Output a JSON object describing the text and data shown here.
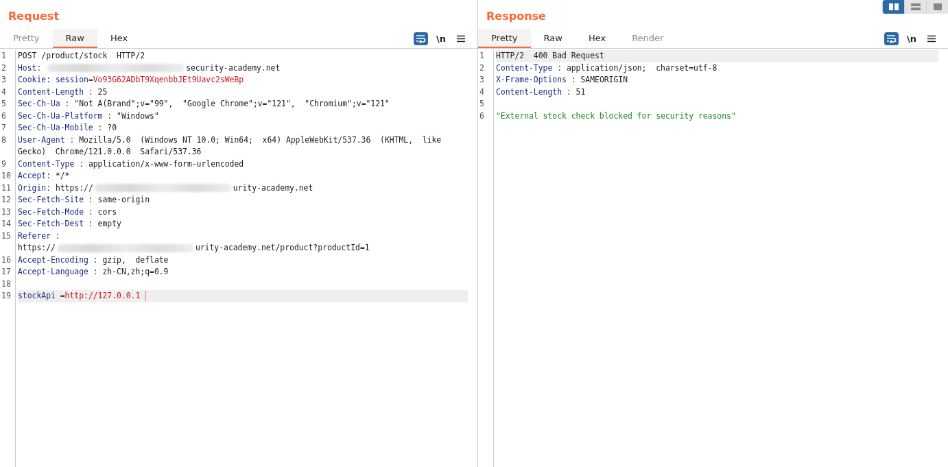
{
  "layout_buttons": [
    {
      "kind": "columns",
      "selected": true
    },
    {
      "kind": "rows",
      "selected": false
    },
    {
      "kind": "single",
      "selected": false
    }
  ],
  "panels": [
    {
      "title": "Request",
      "tabs": [
        {
          "label": "Pretty",
          "selected": false,
          "disabled": true
        },
        {
          "label": "Raw",
          "selected": true,
          "disabled": false
        },
        {
          "label": "Hex",
          "selected": false,
          "disabled": false
        }
      ],
      "wrap_on": true,
      "newline_label": "\\n",
      "lines": [
        {
          "number": "1",
          "current": false,
          "segments": [
            {
              "kind": "plain",
              "text": "POST /product/stock  HTTP/2"
            }
          ]
        },
        {
          "number": "2",
          "current": false,
          "segments": [
            {
              "kind": "name",
              "text": "Host"
            },
            {
              "kind": "sep",
              "text": ": "
            },
            {
              "kind": "redacted"
            },
            {
              "kind": "plain",
              "text": "security-academy.net"
            }
          ]
        },
        {
          "number": "3",
          "current": false,
          "segments": [
            {
              "kind": "name",
              "text": "Cookie"
            },
            {
              "kind": "sep",
              "text": ": "
            },
            {
              "kind": "param",
              "text": "session"
            },
            {
              "kind": "sep",
              "text": "="
            },
            {
              "kind": "param-value",
              "text": "Vo93G62ADbT9XqenbbJEt9Uavc2sWeBp"
            }
          ]
        },
        {
          "number": "4",
          "current": false,
          "segments": [
            {
              "kind": "name",
              "text": "Content-Length"
            },
            {
              "kind": "sep",
              "text": " : "
            },
            {
              "kind": "plain",
              "text": "25"
            }
          ]
        },
        {
          "number": "5",
          "current": false,
          "segments": [
            {
              "kind": "name",
              "text": "Sec-Ch-Ua"
            },
            {
              "kind": "sep",
              "text": " : "
            },
            {
              "kind": "plain",
              "text": "\"Not A(Brand\";v=\"99\",  \"Google Chrome\";v=\"121\",  \"Chromium\";v=\"121\""
            }
          ]
        },
        {
          "number": "6",
          "current": false,
          "segments": [
            {
              "kind": "name",
              "text": "Sec-Ch-Ua-Platform"
            },
            {
              "kind": "sep",
              "text": " : "
            },
            {
              "kind": "plain",
              "text": "\"Windows\""
            }
          ]
        },
        {
          "number": "7",
          "current": false,
          "segments": [
            {
              "kind": "name",
              "text": "Sec-Ch-Ua-Mobile"
            },
            {
              "kind": "sep",
              "text": " : "
            },
            {
              "kind": "plain",
              "text": "?0"
            }
          ]
        },
        {
          "number": "8",
          "current": false,
          "segments": [
            {
              "kind": "name",
              "text": "User-Agent"
            },
            {
              "kind": "sep",
              "text": " : "
            },
            {
              "kind": "plain",
              "text": "Mozilla/5.0  (Windows NT 10.0; Win64;  x64) AppleWebKit/537.36  (KHTML,  like"
            },
            {
              "kind": "break"
            },
            {
              "kind": "plain",
              "text": "Gecko)  Chrome/121.0.0.0  Safari/537.36"
            }
          ]
        },
        {
          "number": "9",
          "current": false,
          "segments": [
            {
              "kind": "name",
              "text": "Content-Type"
            },
            {
              "kind": "sep",
              "text": " : "
            },
            {
              "kind": "plain",
              "text": "application/x-www-form-urlencoded"
            }
          ]
        },
        {
          "number": "10",
          "current": false,
          "segments": [
            {
              "kind": "name",
              "text": "Accept"
            },
            {
              "kind": "sep",
              "text": ": "
            },
            {
              "kind": "plain",
              "text": "*/*"
            }
          ]
        },
        {
          "number": "11",
          "current": false,
          "segments": [
            {
              "kind": "name",
              "text": "Origin"
            },
            {
              "kind": "sep",
              "text": ": "
            },
            {
              "kind": "plain",
              "text": "https://"
            },
            {
              "kind": "redacted"
            },
            {
              "kind": "plain",
              "text": "urity-academy.net"
            }
          ]
        },
        {
          "number": "12",
          "current": false,
          "segments": [
            {
              "kind": "name",
              "text": "Sec-Fetch-Site"
            },
            {
              "kind": "sep",
              "text": " : "
            },
            {
              "kind": "plain",
              "text": "same-origin"
            }
          ]
        },
        {
          "number": "13",
          "current": false,
          "segments": [
            {
              "kind": "name",
              "text": "Sec-Fetch-Mode"
            },
            {
              "kind": "sep",
              "text": " : "
            },
            {
              "kind": "plain",
              "text": "cors"
            }
          ]
        },
        {
          "number": "14",
          "current": false,
          "segments": [
            {
              "kind": "name",
              "text": "Sec-Fetch-Dest"
            },
            {
              "kind": "sep",
              "text": " : "
            },
            {
              "kind": "plain",
              "text": "empty"
            }
          ]
        },
        {
          "number": "15",
          "current": false,
          "segments": [
            {
              "kind": "name",
              "text": "Referer"
            },
            {
              "kind": "sep",
              "text": " :"
            },
            {
              "kind": "break"
            },
            {
              "kind": "plain",
              "text": "https://"
            },
            {
              "kind": "redacted"
            },
            {
              "kind": "plain",
              "text": "urity-academy.net/product?productId=1"
            }
          ]
        },
        {
          "number": "16",
          "current": false,
          "segments": [
            {
              "kind": "name",
              "text": "Accept-Encoding"
            },
            {
              "kind": "sep",
              "text": " : "
            },
            {
              "kind": "plain",
              "text": "gzip,  deflate"
            }
          ]
        },
        {
          "number": "17",
          "current": false,
          "segments": [
            {
              "kind": "name",
              "text": "Accept-Language"
            },
            {
              "kind": "sep",
              "text": " : "
            },
            {
              "kind": "plain",
              "text": "zh-CN,zh;q=0.9"
            }
          ]
        },
        {
          "number": "18",
          "current": false
        },
        {
          "number": "19",
          "current": true,
          "segments": [
            {
              "kind": "param",
              "text": "stockApi"
            },
            {
              "kind": "sep",
              "text": " ="
            },
            {
              "kind": "param-value",
              "text": "http://127.0.0.1"
            },
            {
              "kind": "cursor"
            }
          ]
        }
      ]
    },
    {
      "title": "Response",
      "tabs": [
        {
          "label": "Pretty",
          "selected": true,
          "disabled": false
        },
        {
          "label": "Raw",
          "selected": false,
          "disabled": false
        },
        {
          "label": "Hex",
          "selected": false,
          "disabled": false
        },
        {
          "label": "Render",
          "selected": false,
          "disabled": true
        }
      ],
      "wrap_on": true,
      "newline_label": "\\n",
      "lines": [
        {
          "number": "1",
          "current": true,
          "segments": [
            {
              "kind": "plain",
              "text": "HTTP/2  400 Bad Request"
            }
          ]
        },
        {
          "number": "2",
          "current": false,
          "segments": [
            {
              "kind": "name",
              "text": "Content-Type"
            },
            {
              "kind": "sep",
              "text": " : "
            },
            {
              "kind": "plain",
              "text": "application/json;  charset=utf-8"
            }
          ]
        },
        {
          "number": "3",
          "current": false,
          "segments": [
            {
              "kind": "name",
              "text": "X-Frame-Options"
            },
            {
              "kind": "sep",
              "text": " : "
            },
            {
              "kind": "plain",
              "text": "SAMEORIGIN"
            }
          ]
        },
        {
          "number": "4",
          "current": false,
          "segments": [
            {
              "kind": "name",
              "text": "Content-Length"
            },
            {
              "kind": "sep",
              "text": " : "
            },
            {
              "kind": "plain",
              "text": "51"
            }
          ]
        },
        {
          "number": "5",
          "current": false
        },
        {
          "number": "6",
          "current": false,
          "segments": [
            {
              "kind": "string",
              "text": "\"External stock check blocked for security reasons\""
            }
          ]
        }
      ]
    }
  ]
}
